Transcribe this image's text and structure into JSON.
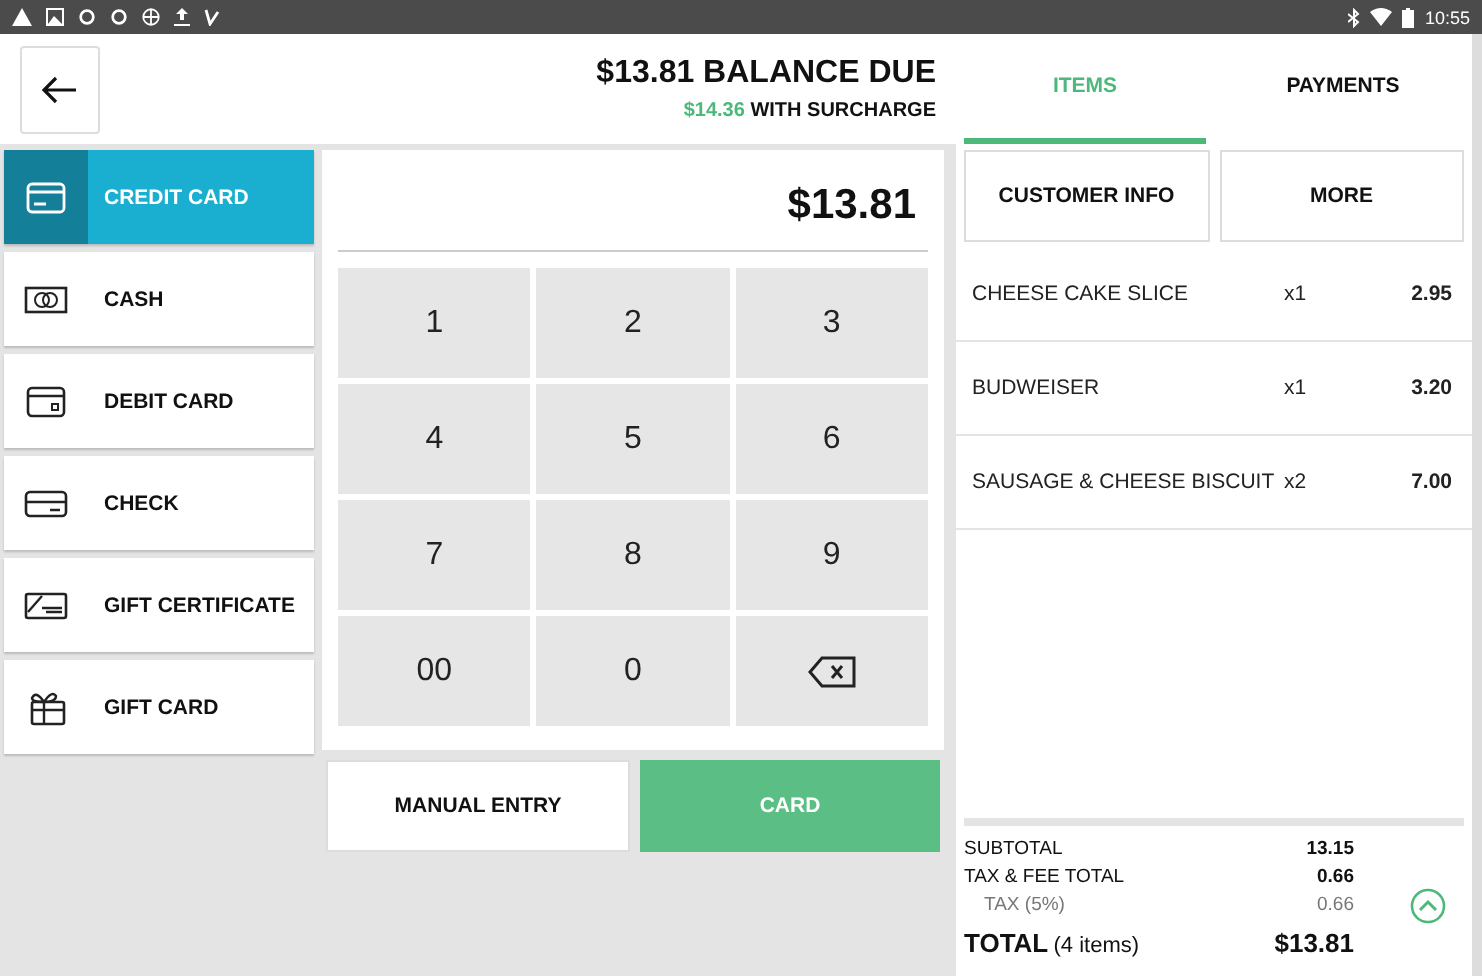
{
  "status_bar": {
    "time": "10:55"
  },
  "header": {
    "balance": "$13.81 BALANCE DUE",
    "surcharge_amount": "$14.36",
    "surcharge_label": "WITH SURCHARGE"
  },
  "payment_methods": [
    {
      "label": "CREDIT CARD",
      "kind": "credit",
      "selected": true
    },
    {
      "label": "CASH",
      "kind": "cash",
      "selected": false
    },
    {
      "label": "DEBIT CARD",
      "kind": "debit",
      "selected": false
    },
    {
      "label": "CHECK",
      "kind": "check",
      "selected": false
    },
    {
      "label": "GIFT CERTIFICATE",
      "kind": "certificate",
      "selected": false
    },
    {
      "label": "GIFT CARD",
      "kind": "gift",
      "selected": false
    }
  ],
  "amount": "$13.81",
  "keys": [
    {
      "kind": "digit",
      "label": "1"
    },
    {
      "kind": "digit",
      "label": "2"
    },
    {
      "kind": "digit",
      "label": "3"
    },
    {
      "kind": "digit",
      "label": "4"
    },
    {
      "kind": "digit",
      "label": "5"
    },
    {
      "kind": "digit",
      "label": "6"
    },
    {
      "kind": "digit",
      "label": "7"
    },
    {
      "kind": "digit",
      "label": "8"
    },
    {
      "kind": "digit",
      "label": "9"
    },
    {
      "kind": "digit",
      "label": "00"
    },
    {
      "kind": "digit",
      "label": "0"
    },
    {
      "kind": "backspace"
    }
  ],
  "actions": {
    "manual": "MANUAL ENTRY",
    "card": "CARD"
  },
  "tabs": [
    {
      "label": "ITEMS",
      "selected": true
    },
    {
      "label": "PAYMENTS",
      "selected": false
    }
  ],
  "order_buttons": [
    "CUSTOMER INFO",
    "MORE"
  ],
  "items": [
    {
      "name": "CHEESE CAKE SLICE",
      "qty": "x1",
      "price": "2.95"
    },
    {
      "name": "BUDWEISER",
      "qty": "x1",
      "price": "3.20"
    },
    {
      "name": "SAUSAGE & CHEESE BISCUIT",
      "qty": "x2",
      "price": "7.00"
    }
  ],
  "totals": {
    "subtotal_label": "SUBTOTAL",
    "subtotal": "13.15",
    "fee_label": "TAX & FEE TOTAL",
    "fee": "0.66",
    "tax_label": "TAX (5%)",
    "tax": "0.66",
    "total_label": "TOTAL",
    "total_count": "(4 items)",
    "total": "$13.81"
  }
}
